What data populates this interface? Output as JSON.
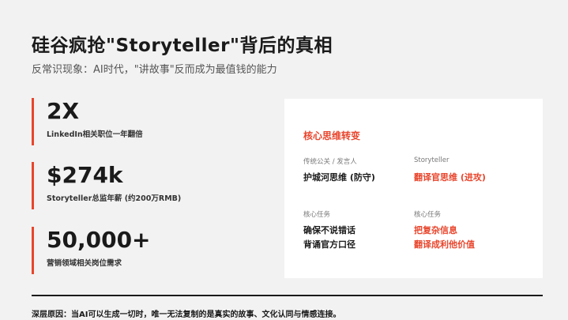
{
  "header": {
    "title": "硅谷疯抢\"Storyteller\"背后的真相",
    "subtitle": "反常识现象：AI时代，\"讲故事\"反而成为最值钱的能力"
  },
  "stats": [
    {
      "value": "2X",
      "label": "LinkedIn相关职位一年翻倍"
    },
    {
      "value": "$274k",
      "label": "Storyteller总监年薪 (约200万RMB)"
    },
    {
      "value": "50,000+",
      "label": "营销领域相关岗位需求"
    }
  ],
  "card": {
    "title": "核心思维转变",
    "left_head_1": "传统公关 / 发言人",
    "left_val_1": "护城河思维 (防守)",
    "right_head_1": "Storyteller",
    "right_val_1": "翻译官思维 (进攻)",
    "left_head_2": "核心任务",
    "left_val_2a": "确保不说错话",
    "left_val_2b": "背诵官方口径",
    "right_head_2": "核心任务",
    "right_val_2a": "把复杂信息",
    "right_val_2b": "翻译成利他价值"
  },
  "footer": {
    "text": "深层原因：当AI可以生成一切时，唯一无法复制的是真实的故事、文化认同与情感连接。"
  },
  "colors": {
    "accent": "#e8452c",
    "background": "#f2f2f2",
    "card": "#ffffff"
  }
}
